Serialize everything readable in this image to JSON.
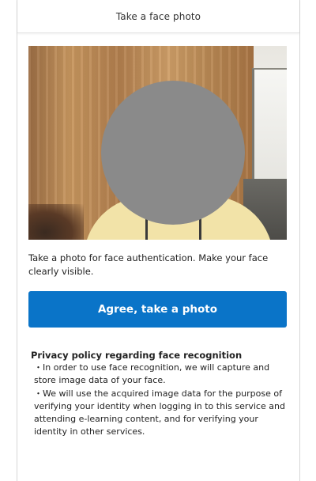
{
  "header": {
    "title": "Take a face photo"
  },
  "instruction": "Take a photo for face authentication. Make your face clearly visible.",
  "agree_button": {
    "label": "Agree, take a photo"
  },
  "privacy": {
    "title": "Privacy policy regarding face recognition",
    "items": [
      "・In order to use face recognition, we will capture and store image data of your face.",
      "・We will use the acquired image data for the purpose of verifying your identity when logging in to this service and attending e-learning content, and for verifying your identity in other services."
    ]
  },
  "colors": {
    "accent": "#0a74c8",
    "face_mask": "#8a8a8a"
  }
}
